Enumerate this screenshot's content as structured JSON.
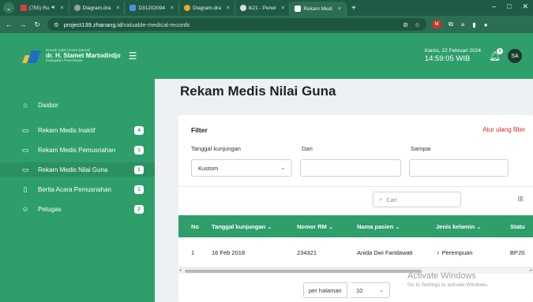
{
  "browser": {
    "tabs": [
      {
        "label": "(755) Ru",
        "fav_color": "#e53935"
      },
      {
        "label": "Diagram.dra",
        "fav_color": "#9aa0a6"
      },
      {
        "label": "D31202094",
        "fav_color": "#4a90e2"
      },
      {
        "label": "Diagram.dra",
        "fav_color": "#f5a623"
      },
      {
        "label": "lk21 - Penel",
        "fav_color": "#dddddd"
      },
      {
        "label": "Rekam Medi",
        "fav_color": "#ffffff"
      }
    ],
    "tab_close": "×",
    "new_tab": "+",
    "url_host": "project139.zhanang.id",
    "url_path": "/valuable-medical-records",
    "window_controls": [
      "–",
      "□",
      "✕"
    ]
  },
  "header": {
    "logo_small": "Rumah Sakit Umum Daerah",
    "logo_name": "dr. H. Slamet Martodirdjo",
    "logo_sub": "Kabupaten Pamekasan",
    "date": "Kamis, 22 Februari 2024",
    "time": "14:59:05 WIB",
    "notification_count": "0",
    "avatar_initials": "SA"
  },
  "sidebar": {
    "items": [
      {
        "label": "Dasbor",
        "badge": "",
        "icon": "home-icon"
      },
      {
        "label": "Rekam Medis Inaktif",
        "badge": "4",
        "icon": "archive-icon"
      },
      {
        "label": "Rekam Medis Pemusnahan",
        "badge": "1",
        "icon": "archive-icon"
      },
      {
        "label": "Rekam Medis Nilai Guna",
        "badge": "1",
        "icon": "archive-icon"
      },
      {
        "label": "Berita Acara Pemusnahan",
        "badge": "1",
        "icon": "document-icon"
      },
      {
        "label": "Petugas",
        "badge": "2",
        "icon": "users-icon"
      }
    ],
    "active_index": 3
  },
  "main": {
    "title": "Rekam Medis Nilai Guna",
    "filter": {
      "heading": "Filter",
      "reset": "Atur ulang filter",
      "visit_date_label": "Tanggal kunjungan",
      "visit_date_value": "Kustom",
      "from_label": "Dari",
      "from_value": "",
      "to_label": "Sampai",
      "to_value": ""
    },
    "search_placeholder": "Cari",
    "table": {
      "columns": [
        "No",
        "Tanggal kunjungan",
        "Nomor RM",
        "Nama pasien",
        "Jenis kelamin",
        "Statu"
      ],
      "rows": [
        {
          "no": "1",
          "date": "16 Feb 2018",
          "rm": "234321",
          "name": "Anida Dwi Faridawati",
          "gender": "Perempuan",
          "status": "BPJS"
        }
      ]
    },
    "pagination": {
      "per_page_label": "per halaman",
      "per_page_value": "10"
    }
  },
  "watermark": {
    "line1": "Activate Windows",
    "line2": "Go to Settings to activate Windows."
  },
  "colors": {
    "brand_green": "#2e9e6b",
    "browser_green": "#2c6e53",
    "danger_red": "#d0242a"
  }
}
